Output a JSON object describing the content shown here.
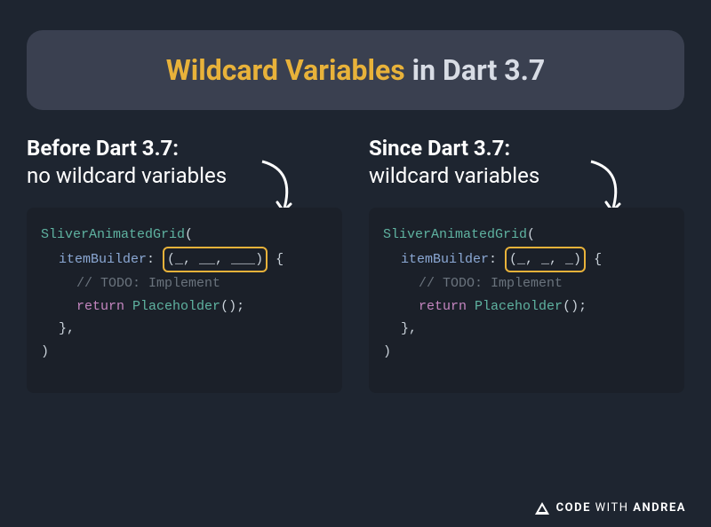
{
  "title": {
    "accent": "Wildcard Variables",
    "rest": " in Dart 3.7"
  },
  "left": {
    "heading_bold": "Before Dart 3.7:",
    "heading_normal": "no wildcard variables",
    "code": {
      "class_name": "SliverAnimatedGrid",
      "param_name": "itemBuilder",
      "wildcards": "(_, __, ___)",
      "comment": "// TODO: Implement",
      "return_kw": "return",
      "placeholder": "Placeholder"
    }
  },
  "right": {
    "heading_bold": "Since Dart 3.7:",
    "heading_normal": "wildcard variables",
    "code": {
      "class_name": "SliverAnimatedGrid",
      "param_name": "itemBuilder",
      "wildcards": "(_, _, _)",
      "comment": "// TODO: Implement",
      "return_kw": "return",
      "placeholder": "Placeholder"
    }
  },
  "brand": {
    "code": "CODE",
    "with": " WITH ",
    "andrea": "ANDREA"
  }
}
